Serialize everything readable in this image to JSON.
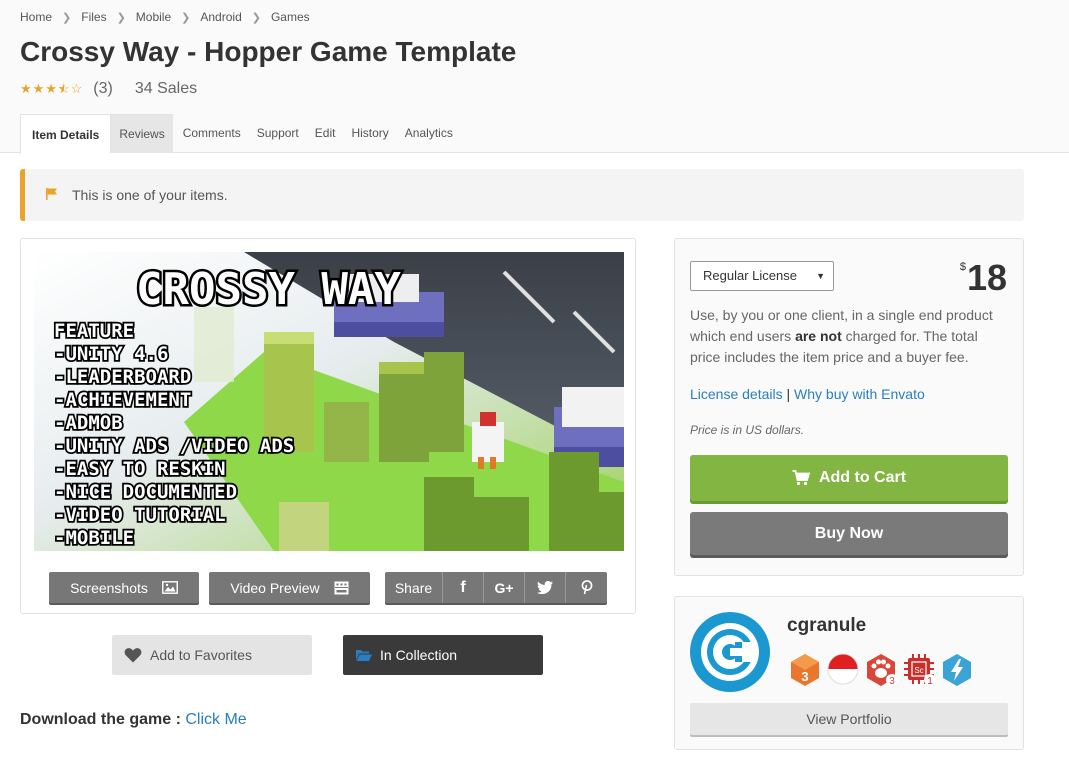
{
  "breadcrumb": [
    "Home",
    "Files",
    "Mobile",
    "Android",
    "Games"
  ],
  "title": "Crossy Way - Hopper Game Template",
  "rating": {
    "stars": 3.5,
    "count": "(3)",
    "sales": "34 Sales"
  },
  "tabs": [
    "Item Details",
    "Reviews",
    "Comments",
    "Support",
    "Edit",
    "History",
    "Analytics"
  ],
  "notice": "This is one of your items.",
  "preview_image": {
    "heading": "CROSSY WAY",
    "feature_title": "FEATURE",
    "features": [
      "-UNITY 4.6",
      "-LEADERBOARD",
      "-ACHIEVEMENT",
      "-ADMOB",
      "-UNITY ADS /VIDEO ADS",
      "-EASY TO RESKIN",
      "-NICE DOCUMENTED",
      "-VIDEO TUTORIAL",
      "-MOBILE"
    ]
  },
  "preview_buttons": {
    "screenshots": "Screenshots",
    "video": "Video Preview",
    "share": "Share"
  },
  "favorites": "Add to Favorites",
  "collection": "In Collection",
  "download": {
    "label": "Download the game :",
    "link": "Click Me"
  },
  "license": {
    "selected": "Regular License",
    "currency": "$",
    "price": "18",
    "desc_1": "Use, by you or one client, in a single end product which end users ",
    "desc_bold": "are not",
    "desc_2": " charged for. The total price includes the item price and a buyer fee.",
    "link_details": "License details",
    "pipe": "|",
    "link_why": "Why buy with Envato",
    "note": "Price is in US dollars.",
    "cart": "Add to Cart",
    "buy": "Buy Now"
  },
  "author": {
    "name": "cgranule",
    "portfolio": "View Portfolio",
    "badge_numbers": [
      "3",
      "3",
      "1"
    ]
  },
  "colors": {
    "accent_green": "#82b541",
    "star": "#e8a52c",
    "link": "#2a7ec0",
    "avatar_blue": "#1b98d0"
  }
}
